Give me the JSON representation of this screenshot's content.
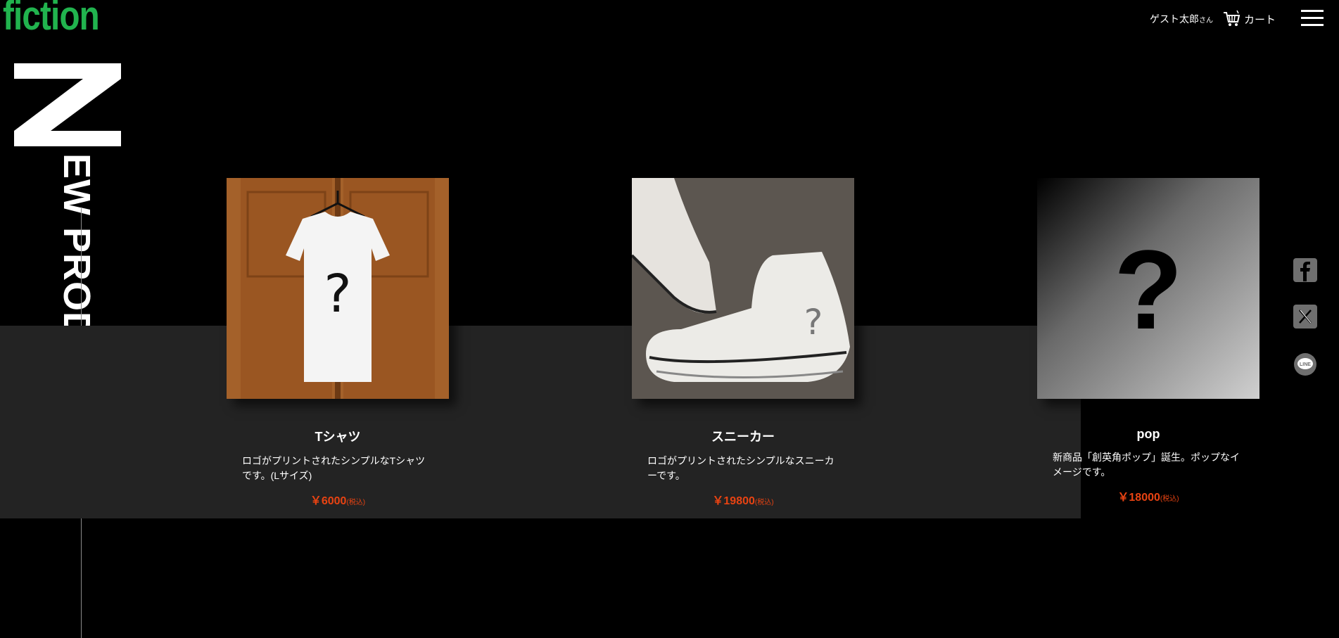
{
  "header": {
    "logo": "fiction",
    "user_name": "ゲスト太郎",
    "user_suffix": "さん",
    "cart_label": "カート"
  },
  "section": {
    "initial": "N",
    "title_rest": "EW PRODUCTS"
  },
  "products": [
    {
      "name": "Tシャツ",
      "description": "ロゴがプリントされたシンプルなTシャツです。(Lサイズ)",
      "price": "￥6000",
      "tax_note": "(税込)"
    },
    {
      "name": "スニーカー",
      "description": "ロゴがプリントされたシンプルなスニーカーです。",
      "price": "￥19800",
      "tax_note": "(税込)"
    },
    {
      "name": "pop",
      "description": "新商品「創英角ポップ」誕生。ポップなイメージです。",
      "price": "￥18000",
      "tax_note": "(税込)"
    }
  ],
  "social": [
    "facebook-icon",
    "x-icon",
    "line-icon"
  ],
  "colors": {
    "logo": "#21b34e",
    "price": "#e84312",
    "band": "#232323"
  }
}
